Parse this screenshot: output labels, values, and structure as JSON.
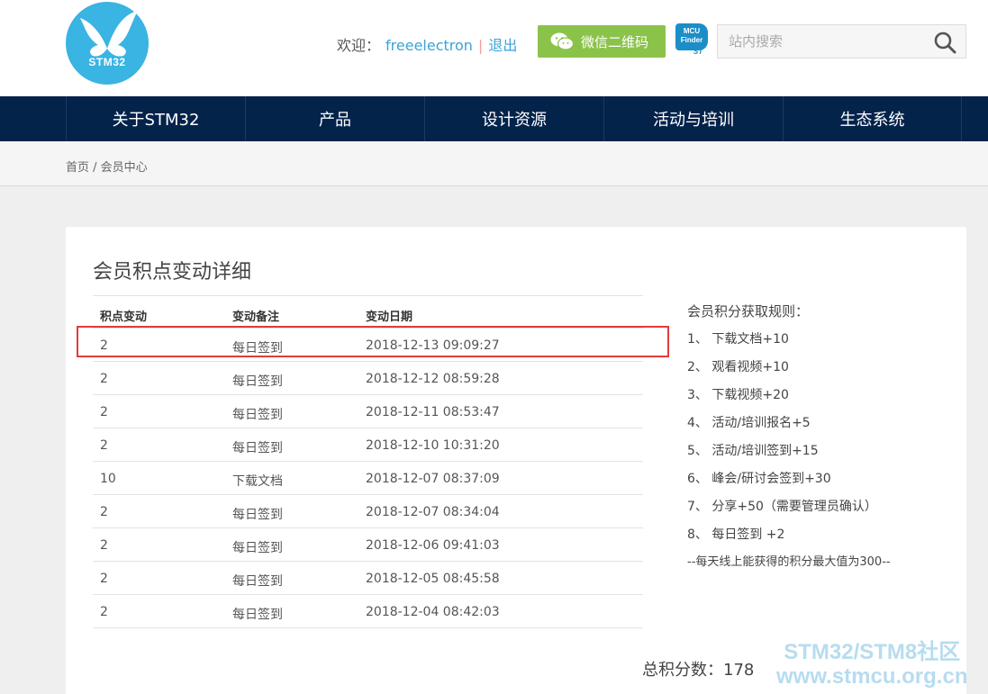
{
  "header": {
    "logo_text": "STM32",
    "welcome_label": "欢迎：",
    "username": "freeelectron",
    "separator": "|",
    "logout_label": "退出",
    "wechat_button": "微信二维码",
    "mcu_finder_line1": "MCU",
    "mcu_finder_line2": "Finder",
    "mcu_finder_brand": "ST",
    "search_placeholder": "站内搜索"
  },
  "nav": [
    "关于STM32",
    "产品",
    "设计资源",
    "活动与培训",
    "生态系统"
  ],
  "breadcrumb": "首页 / 会员中心",
  "main": {
    "title": "会员积点变动详细",
    "columns": [
      "积点变动",
      "变动备注",
      "变动日期"
    ],
    "rows": [
      {
        "points": "2",
        "note": "每日签到",
        "date": "2018-12-13 09:09:27"
      },
      {
        "points": "2",
        "note": "每日签到",
        "date": "2018-12-12 08:59:28"
      },
      {
        "points": "2",
        "note": "每日签到",
        "date": "2018-12-11 08:53:47"
      },
      {
        "points": "2",
        "note": "每日签到",
        "date": "2018-12-10 10:31:20"
      },
      {
        "points": "10",
        "note": "下载文档",
        "date": "2018-12-07 08:37:09"
      },
      {
        "points": "2",
        "note": "每日签到",
        "date": "2018-12-07 08:34:04"
      },
      {
        "points": "2",
        "note": "每日签到",
        "date": "2018-12-06 09:41:03"
      },
      {
        "points": "2",
        "note": "每日签到",
        "date": "2018-12-05 08:45:58"
      },
      {
        "points": "2",
        "note": "每日签到",
        "date": "2018-12-04 08:42:03"
      }
    ],
    "total": "总积分数：178"
  },
  "rules": {
    "title": "会员积分获取规则：",
    "items": [
      "1、 下载文档+10",
      "2、 观看视频+10",
      "3、 下载视频+20",
      "4、 活动/培训报名+5",
      "5、 活动/培训签到+15",
      "6、 峰会/研讨会签到+30",
      "7、 分享+50（需要管理员确认）",
      "8、 每日签到 +2"
    ],
    "note": "--每天线上能获得的积分最大值为300--"
  },
  "watermark": {
    "line1": "STM32/STM8社区",
    "line2": "www.stmcu.org.cn"
  },
  "colors": {
    "nav_bg": "#03234b",
    "logo_blue": "#39b4e3",
    "wechat_green": "#8bc34a",
    "link_blue": "#3ba3d6",
    "highlight_red": "#e23b3b"
  }
}
